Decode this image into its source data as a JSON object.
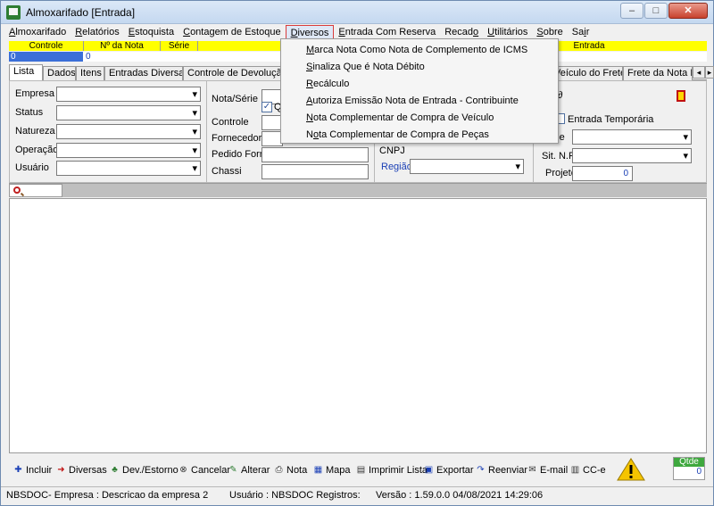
{
  "window": {
    "title": "Almoxarifado [Entrada]",
    "min": "–",
    "max": "□",
    "close": "✕"
  },
  "menu": [
    {
      "u": "A",
      "rest": "lmoxarifado"
    },
    {
      "u": "R",
      "rest": "elatórios"
    },
    {
      "u": "E",
      "rest": "stoquista"
    },
    {
      "u": "C",
      "rest": "ontagem de Estoque"
    },
    {
      "u": "D",
      "rest": "iversos"
    },
    {
      "u": "E",
      "rest": "ntrada Com Reserva"
    },
    {
      "pre": "Recad",
      "u": "o",
      "rest": ""
    },
    {
      "u": "U",
      "rest": "tilitários"
    },
    {
      "u": "S",
      "rest": "obre"
    },
    {
      "pre": "Sa",
      "u": "i",
      "rest": "r"
    }
  ],
  "grid": {
    "headers": [
      "Controle",
      "Nº da Nota",
      "Série",
      "Entrada"
    ],
    "row": [
      "0",
      "0"
    ]
  },
  "tabs": [
    "Lista",
    "Dados",
    "Itens",
    "Entradas Diversas",
    "Controle de Devolução d",
    "Veículo do Frete",
    "Frete da Nota F"
  ],
  "filters": {
    "left": [
      "Empresa",
      "Status",
      "Natureza",
      "Operação",
      "Usuário"
    ],
    "mid": [
      "Nota/Série",
      "Controle",
      "Fornecedor",
      "Pedido Forn.",
      "Chassi"
    ],
    "q_label": "Q",
    "cnpj": "CNPJ",
    "regiao": "Região",
    "entrada_temporaria": "Entrada Temporária",
    "sit_nf": "Sit. N.F.",
    "e_label": "-e",
    "projeto": "Projeto",
    "projeto_value": "0"
  },
  "dropdown": [
    {
      "u": "M",
      "rest": "arca Nota Como Nota de Complemento de ICMS"
    },
    {
      "u": "S",
      "rest": "inaliza Que é Nota Débito"
    },
    {
      "u": "R",
      "rest": "ecálculo"
    },
    {
      "u": "A",
      "rest": "utoriza Emissão Nota de Entrada - Contribuinte"
    },
    {
      "u": "N",
      "rest": "ota Complementar de Compra de Veículo"
    },
    {
      "pre": "N",
      "u": "o",
      "rest": "ta Complementar de Compra de Peças"
    }
  ],
  "toolbar": [
    "Incluir",
    "Diversas",
    "Dev./Estorno",
    "Cancelar",
    "Alterar",
    "Nota",
    "Mapa",
    "Imprimir Lista",
    "Exportar",
    "Reenviar",
    "E-mail",
    "CC-e"
  ],
  "qtde": {
    "label": "Qtde",
    "value": "0"
  },
  "status": {
    "left": "NBSDOC- Empresa : Descricao da empresa 2",
    "user": "Usuário : NBSDOC Registros:",
    "version": "Versão : 1.59.0.0  04/08/2021 14:29:06"
  }
}
